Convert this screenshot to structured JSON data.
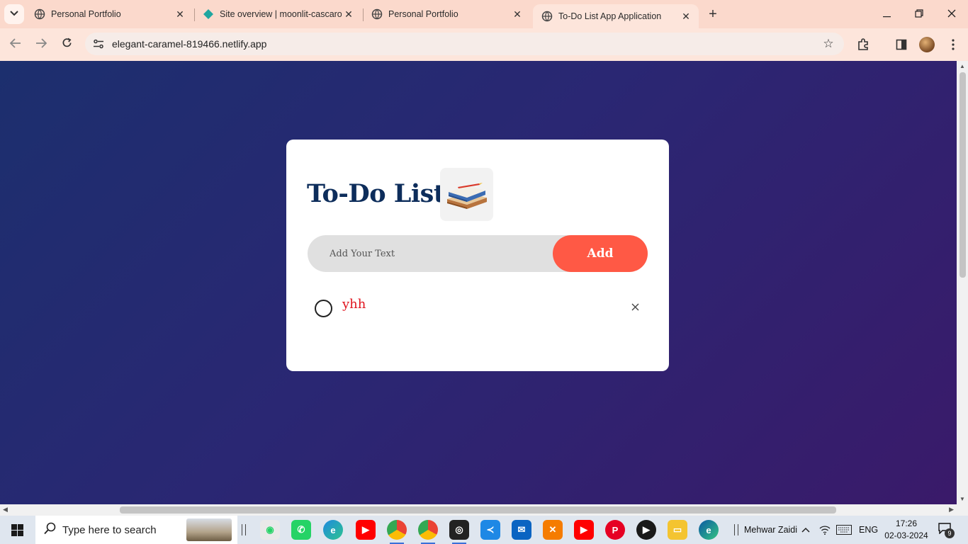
{
  "browser": {
    "tabs": [
      {
        "title": "Personal Portfolio",
        "favicon": "globe-icon",
        "active": false
      },
      {
        "title": "Site overview | moonlit-cascaron",
        "favicon": "netlify-icon",
        "active": false
      },
      {
        "title": "Personal Portfolio",
        "favicon": "globe-icon",
        "active": false
      },
      {
        "title": "To-Do List App Application",
        "favicon": "globe-icon",
        "active": true
      }
    ],
    "url": "elegant-caramel-819466.netlify.app",
    "accent_color": "#fbd9cc"
  },
  "app": {
    "title": "To-Do List",
    "input_placeholder": "Add Your Text",
    "input_value": "",
    "add_label": "Add",
    "add_color": "#ff5945",
    "tasks": [
      {
        "text": "yhh",
        "checked": false
      }
    ]
  },
  "taskbar": {
    "search_placeholder": "Type here to search",
    "apps": [
      "whatsapp-alt-icon",
      "whatsapp-icon",
      "edge-beta-icon",
      "youtube-icon",
      "chrome-icon",
      "chrome-alt-icon",
      "camera-app-icon",
      "vscode-icon",
      "mail-icon",
      "xampp-icon",
      "youtube-alt-icon",
      "pinterest-icon",
      "media-player-icon",
      "file-explorer-icon",
      "edge-icon"
    ],
    "user": "Mehwar Zaidi",
    "language": "ENG",
    "time": "17:26",
    "date": "02-03-2024",
    "notification_count": "9"
  }
}
